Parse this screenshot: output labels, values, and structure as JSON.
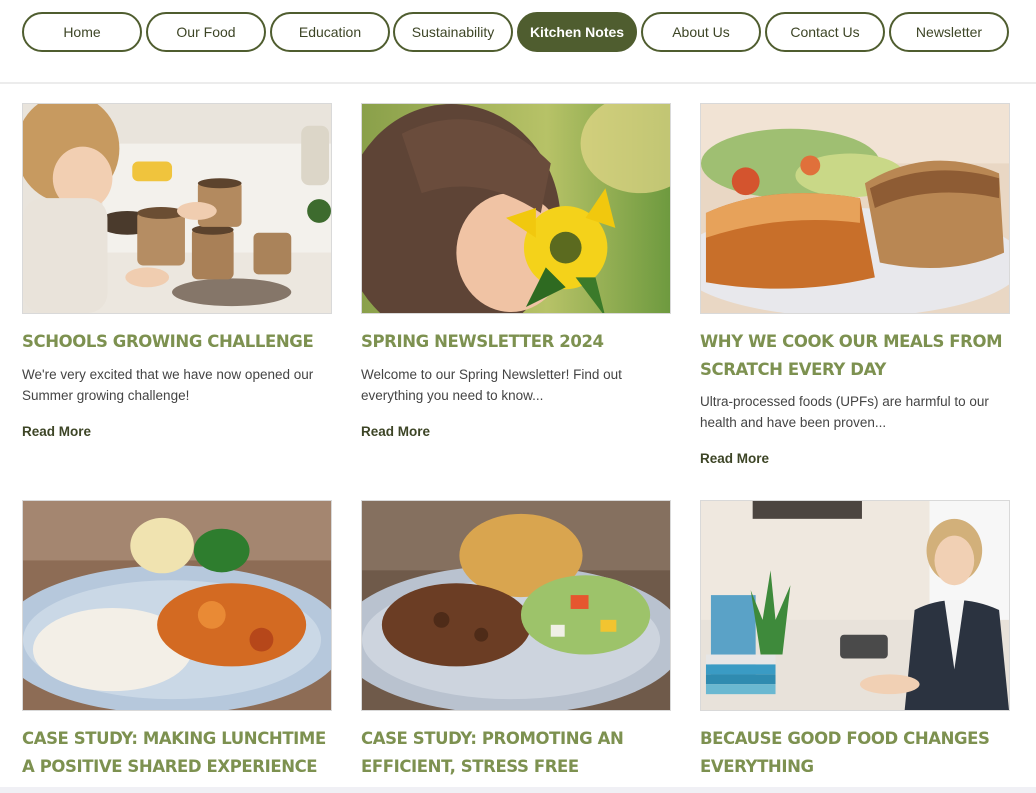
{
  "nav": {
    "items": [
      {
        "label": "Home"
      },
      {
        "label": "Our Food"
      },
      {
        "label": "Education"
      },
      {
        "label": "Sustainability"
      },
      {
        "label": "Kitchen Notes",
        "active": true
      },
      {
        "label": "About Us"
      },
      {
        "label": "Contact Us"
      },
      {
        "label": "Newsletter"
      }
    ]
  },
  "posts": [
    {
      "title": "SCHOOLS GROWING CHALLENGE",
      "excerpt": "We're very excited that we have now opened our Summer growing challenge!",
      "read_more": "Read More",
      "image": "child-planting-seeds"
    },
    {
      "title": "SPRING NEWSLETTER 2024",
      "excerpt": "Welcome to our Spring Newsletter! Find out everything you need to know...",
      "read_more": "Read More",
      "image": "child-smelling-sunflower"
    },
    {
      "title": "WHY WE COOK OUR MEALS FROM SCRATCH EVERY DAY",
      "excerpt": "Ultra-processed foods (UPFs) are harmful to our health and have been proven...",
      "read_more": "Read More",
      "image": "lasagne-and-bread-plate"
    },
    {
      "title": "CASE STUDY: MAKING LUNCHTIME A POSITIVE SHARED EXPERIENCE",
      "image": "curry-rice-plate"
    },
    {
      "title": "CASE STUDY: PROMOTING AN EFFICIENT, STRESS FREE LUNCHTIME SERVICE",
      "image": "mince-salad-plate"
    },
    {
      "title": "BECAUSE GOOD FOOD CHANGES EVERYTHING",
      "image": "woman-at-desk"
    }
  ],
  "colors": {
    "accent": "#4f5d2f",
    "title": "#7d9150"
  }
}
